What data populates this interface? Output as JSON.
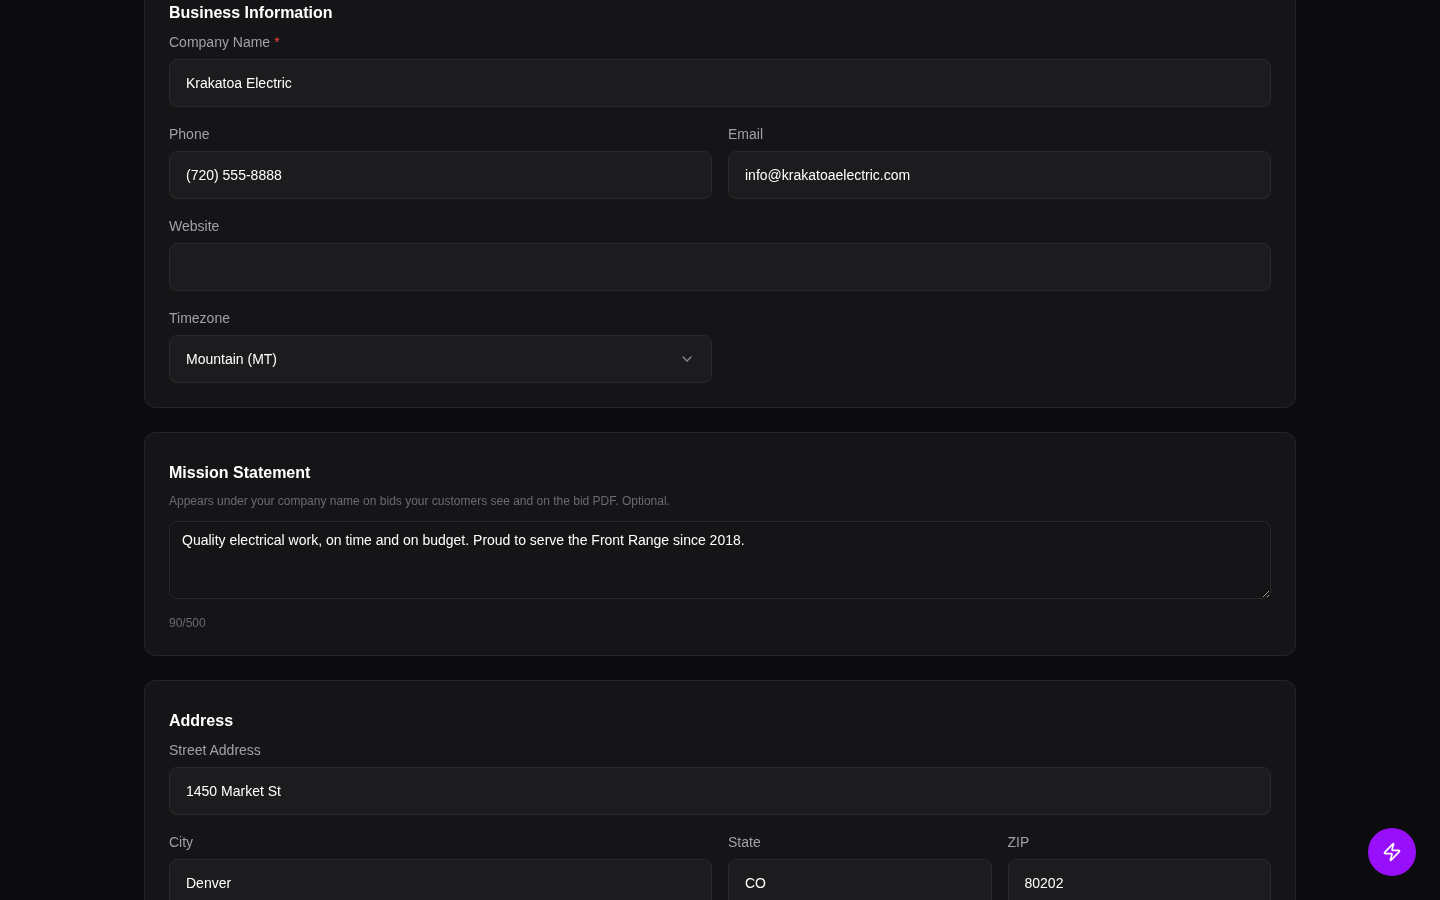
{
  "sections": [
    {
      "title": "Business Information",
      "rows": [
        [
          {
            "kind": "input",
            "label": "Company Name",
            "required_mark": "*",
            "value": "Krakatoa Electric"
          }
        ],
        [
          {
            "kind": "input",
            "label": "Phone",
            "value": "(720) 555-8888"
          },
          {
            "kind": "input",
            "label": "Email",
            "value": "info@krakatoaelectric.com"
          }
        ],
        [
          {
            "kind": "input",
            "label": "Website"
          }
        ],
        [
          {
            "kind": "select",
            "label": "Timezone",
            "value": "Mountain (MT)"
          }
        ]
      ]
    },
    {
      "title": "Mission Statement",
      "description": "Appears under your company name on bids your customers see and on the bid PDF. Optional.",
      "rows": [
        [
          {
            "kind": "textarea",
            "value": "Quality electrical work, on time and on budget. Proud to serve the Front Range since 2018.",
            "counter": "90/500"
          }
        ]
      ]
    },
    {
      "title": "Address",
      "rows": [
        [
          {
            "kind": "input",
            "label": "Street Address",
            "value": "1450 Market St"
          }
        ],
        [
          {
            "kind": "input",
            "label": "City",
            "value": "Denver"
          },
          {
            "kind": "input",
            "label": "State",
            "value": "CO"
          },
          {
            "kind": "input",
            "label": "ZIP",
            "value": "80202"
          }
        ]
      ]
    }
  ]
}
